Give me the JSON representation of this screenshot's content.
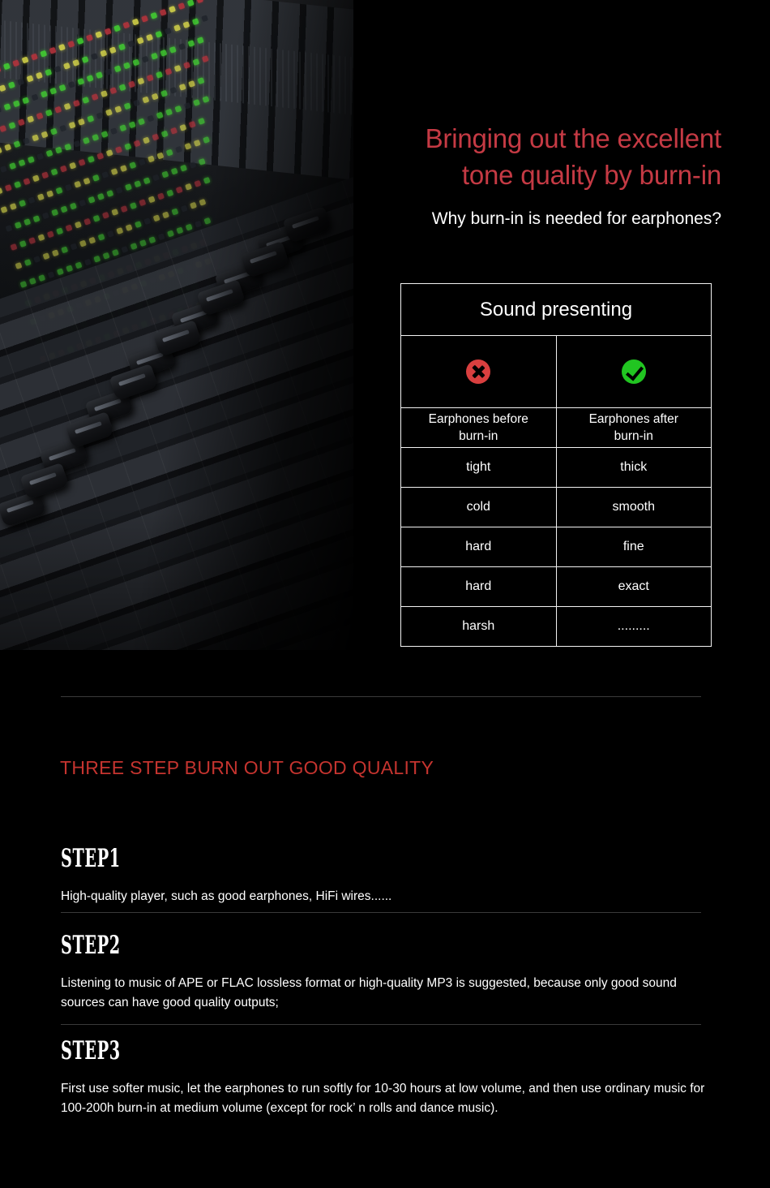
{
  "hero": {
    "title_line1": "Bringing out the excellent",
    "title_line2": "tone quality by burn-in",
    "subtitle": "Why burn-in is needed for earphones?",
    "title_color": "#c53a44",
    "photo_alt": "audio-mixing-console"
  },
  "table": {
    "header": "Sound presenting",
    "icon_bad": "red-x-circle-icon",
    "icon_good": "green-check-circle-icon",
    "icon_bad_color": "#d93f3f",
    "icon_good_color": "#21c521",
    "col_label_before": "Earphones before burn-in",
    "col_label_after": "Earphones after burn-in",
    "rows": [
      {
        "before": "tight",
        "after": "thick"
      },
      {
        "before": "cold",
        "after": "smooth"
      },
      {
        "before": "hard",
        "after": "fine"
      },
      {
        "before": "hard",
        "after": "exact"
      },
      {
        "before": "harsh",
        "after": "........."
      }
    ]
  },
  "steps_section": {
    "title": "THREE STEP BURN OUT GOOD QUALITY",
    "title_color": "#c5342f",
    "items": [
      {
        "label": "STEP1",
        "body": "High-quality player, such as good earphones, HiFi wires......"
      },
      {
        "label": "STEP2",
        "body": "Listening to music of APE or FLAC lossless format or high-quality MP3 is suggested, because only good sound sources can have good quality outputs;"
      },
      {
        "label": "STEP3",
        "body": "First use softer music, let the earphones to run softly for 10-30 hours at low volume, and then use ordinary music for 100-200h burn-in at medium volume (except for rock’ n rolls and dance music)."
      }
    ]
  }
}
